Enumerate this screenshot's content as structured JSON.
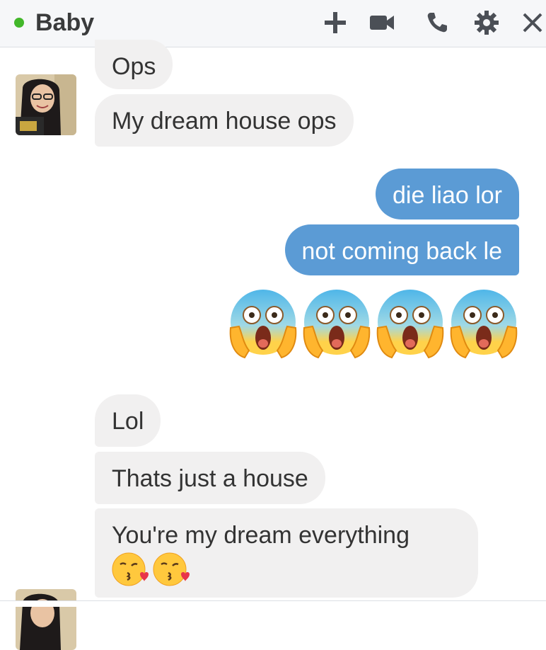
{
  "header": {
    "contact_name": "Baby",
    "status_color": "#42b72a",
    "icons": [
      "plus-icon",
      "video-camera-icon",
      "phone-icon",
      "gear-icon",
      "close-icon"
    ]
  },
  "messages": {
    "ops": "Ops",
    "dream_house": "My dream house ops",
    "die_liao": "die liao lor",
    "not_coming": "not coming back le",
    "lol": "Lol",
    "just_house": "Thats just a house",
    "dream_everything": "You're my dream everything"
  },
  "emoji": {
    "scream_count": 4,
    "kiss_count": 2
  },
  "colors": {
    "outgoing_bubble": "#5b9bd5",
    "incoming_bubble": "#f1f0f0"
  }
}
